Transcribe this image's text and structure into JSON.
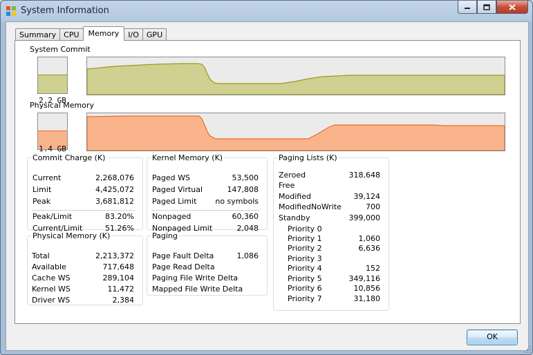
{
  "window": {
    "title": "System Information"
  },
  "tabs": [
    {
      "label": "Summary"
    },
    {
      "label": "CPU"
    },
    {
      "label": "Memory"
    },
    {
      "label": "I/O"
    },
    {
      "label": "GPU"
    }
  ],
  "active_tab": "Memory",
  "system_commit": {
    "label": "System Commit",
    "value": "2.2 GB",
    "fill_fraction": 0.5
  },
  "physical_memory_graph": {
    "label": "Physical Memory",
    "value": "1.4 GB",
    "fill_fraction": 0.5
  },
  "colors": {
    "commit_fill": "#d0d090",
    "commit_line": "#9a9a1e",
    "physical_fill": "#f9b48c",
    "physical_line": "#ee6a25",
    "graph_bg": "#ebebeb"
  },
  "commit_charge": {
    "title": "Commit Charge (K)",
    "rows": [
      {
        "key": "Current",
        "value": "2,268,076"
      },
      {
        "key": "Limit",
        "value": "4,425,072"
      },
      {
        "key": "Peak",
        "value": "3,681,812"
      }
    ],
    "ratios": [
      {
        "key": "Peak/Limit",
        "value": "83.20%"
      },
      {
        "key": "Current/Limit",
        "value": "51.26%"
      }
    ]
  },
  "physical_memory": {
    "title": "Physical Memory (K)",
    "rows": [
      {
        "key": "Total",
        "value": "2,213,372"
      },
      {
        "key": "Available",
        "value": "717,648"
      },
      {
        "key": "Cache WS",
        "value": "289,104"
      },
      {
        "key": "Kernel WS",
        "value": "11,472"
      },
      {
        "key": "Driver WS",
        "value": "2,384"
      }
    ]
  },
  "kernel_memory": {
    "title": "Kernel Memory (K)",
    "rows": [
      {
        "key": "Paged WS",
        "value": "53,500"
      },
      {
        "key": "Paged Virtual",
        "value": "147,808"
      },
      {
        "key": "Paged Limit",
        "value": "no symbols"
      }
    ],
    "rows2": [
      {
        "key": "Nonpaged",
        "value": "60,360"
      },
      {
        "key": "Nonpaged Limit",
        "value": "2,048"
      }
    ]
  },
  "paging": {
    "title": "Paging",
    "rows": [
      {
        "key": "Page Fault Delta",
        "value": "1,086"
      },
      {
        "key": "Page Read Delta",
        "value": ""
      },
      {
        "key": "Paging File Write Delta",
        "value": ""
      },
      {
        "key": "Mapped File Write Delta",
        "value": ""
      }
    ]
  },
  "paging_lists": {
    "title": "Paging Lists (K)",
    "rows": [
      {
        "key": "Zeroed",
        "value": "318,648"
      },
      {
        "key": "Free",
        "value": ""
      },
      {
        "key": "Modified",
        "value": "39,124"
      },
      {
        "key": "ModifiedNoWrite",
        "value": "700"
      },
      {
        "key": "Standby",
        "value": "399,000"
      }
    ],
    "priorities": [
      {
        "key": "Priority 0",
        "value": ""
      },
      {
        "key": "Priority 1",
        "value": "1,060"
      },
      {
        "key": "Priority 2",
        "value": "6,636"
      },
      {
        "key": "Priority 3",
        "value": ""
      },
      {
        "key": "Priority 4",
        "value": "152"
      },
      {
        "key": "Priority 5",
        "value": "349,116"
      },
      {
        "key": "Priority 6",
        "value": "10,856"
      },
      {
        "key": "Priority 7",
        "value": "31,180"
      }
    ]
  },
  "buttons": {
    "ok": "OK"
  }
}
